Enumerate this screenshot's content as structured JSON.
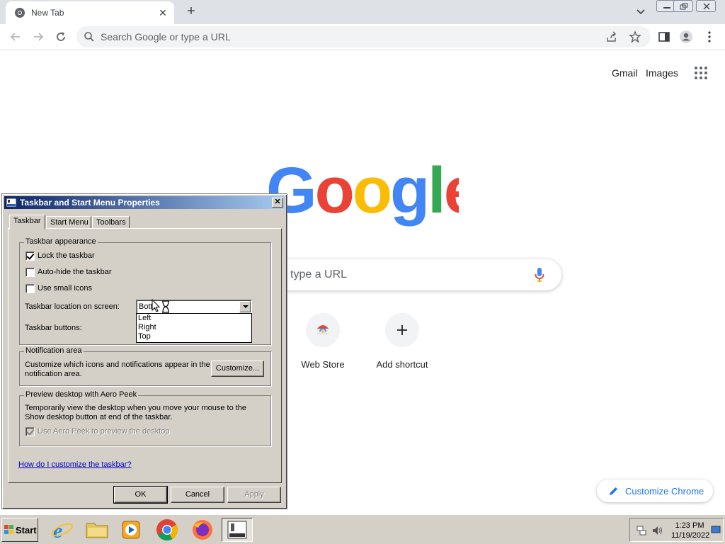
{
  "browser": {
    "tab_title": "New Tab",
    "omnibox_placeholder": "Search Google or type a URL"
  },
  "ntp": {
    "gmail": "Gmail",
    "images": "Images",
    "search_placeholder": "type a URL",
    "shortcuts": [
      {
        "label": "Web Store"
      },
      {
        "label": "Add shortcut"
      }
    ],
    "customize_label": "Customize Chrome"
  },
  "dialog": {
    "title": "Taskbar and Start Menu Properties",
    "tabs": [
      "Taskbar",
      "Start Menu",
      "Toolbars"
    ],
    "appearance": {
      "legend": "Taskbar appearance",
      "lock": {
        "label": "Lock the taskbar",
        "checked": true
      },
      "autohide": {
        "label": "Auto-hide the taskbar",
        "checked": false
      },
      "small_icons": {
        "label": "Use small icons",
        "checked": false
      },
      "location_label": "Taskbar location on screen:",
      "location_value": "Botto",
      "location_options": [
        "Left",
        "Right",
        "Top"
      ],
      "buttons_label": "Taskbar buttons:"
    },
    "notification": {
      "legend": "Notification area",
      "text": "Customize which icons and notifications appear in the notification area.",
      "button": "Customize..."
    },
    "peek": {
      "legend": "Preview desktop with Aero Peek",
      "text": "Temporarily view the desktop when you move your mouse to the Show desktop button at end of the taskbar.",
      "checkbox_label": "Use Aero Peek to preview the desktop"
    },
    "help_link": "How do I customize the taskbar?",
    "ok": "OK",
    "cancel": "Cancel",
    "apply": "Apply"
  },
  "taskbar": {
    "start_label": "Start",
    "time": "1:23 PM",
    "date": "11/19/2022"
  }
}
